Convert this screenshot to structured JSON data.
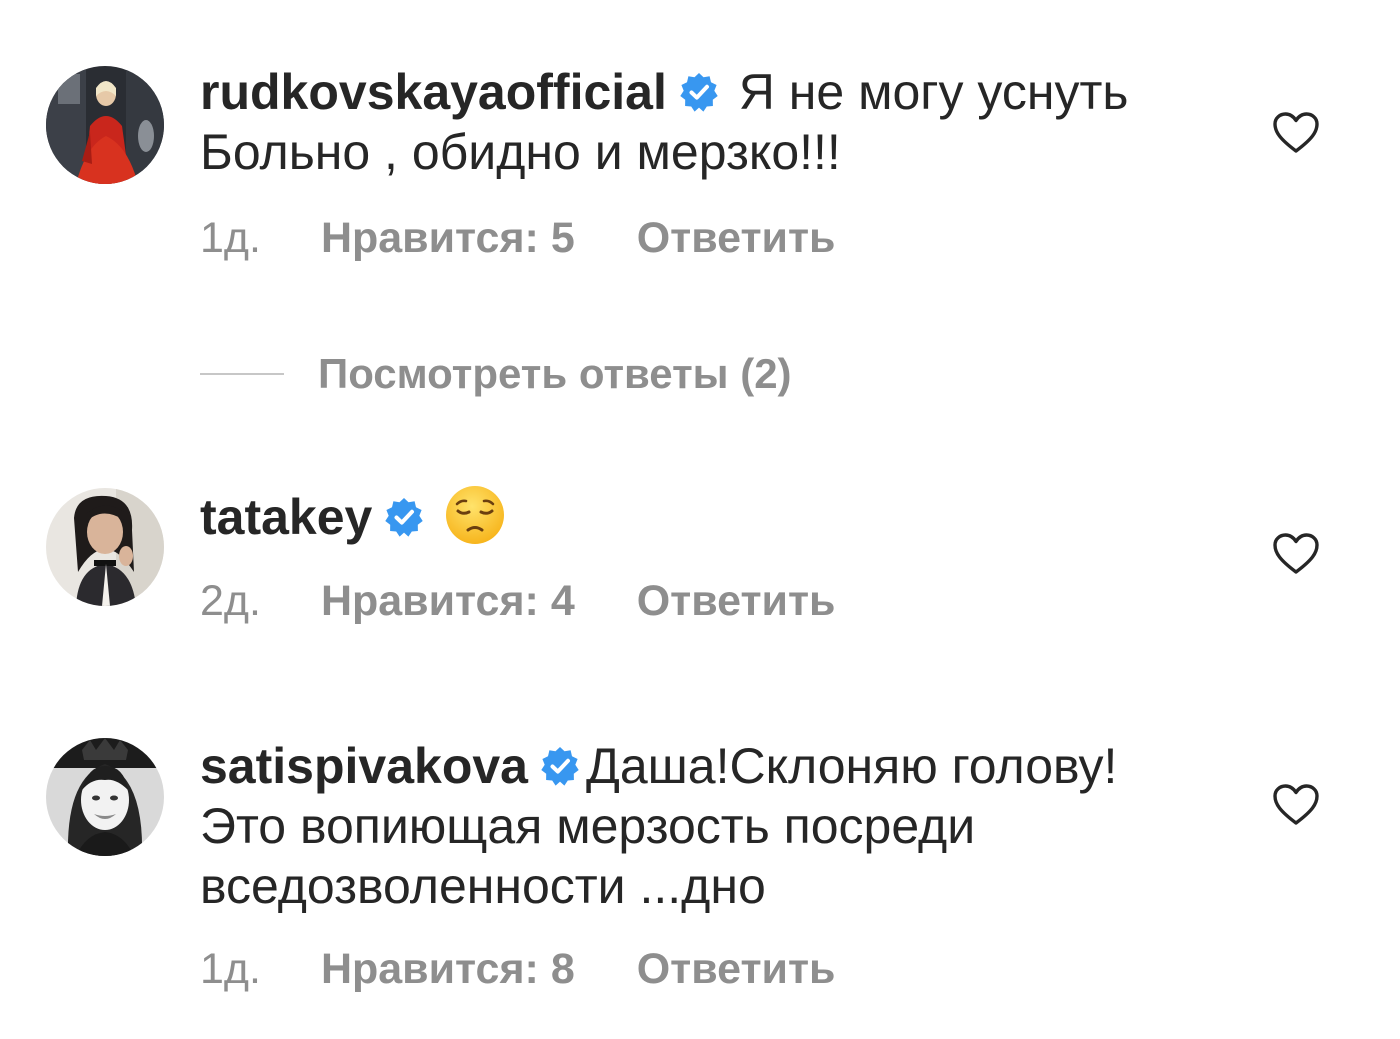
{
  "colors": {
    "text": "#262626",
    "secondary": "#8e8e8e",
    "verified": "#3897f0",
    "divider": "#c7c7c7"
  },
  "comments": [
    {
      "username": "rudkovskayaofficial",
      "verified": true,
      "text_line1": "Я не могу уснуть",
      "text_line2": "Больно , обидно и мерзко!!!",
      "time": "1д.",
      "likes": "Нравится: 5",
      "reply": "Ответить",
      "like_icon": "heart-outline-icon"
    },
    {
      "username": "tatakey",
      "verified": true,
      "emoji": "pensive-face-emoji",
      "time": "2д.",
      "likes": "Нравится: 4",
      "reply": "Ответить",
      "like_icon": "heart-outline-icon"
    },
    {
      "username": "satispivakova",
      "verified": true,
      "text_line1": "Даша!Склоняю голову!",
      "text_line2": "Это вопиющая мерзость посреди",
      "text_line3": "вседозволенности ...дно",
      "time": "1д.",
      "likes": "Нравится: 8",
      "reply": "Ответить",
      "like_icon": "heart-outline-icon"
    }
  ],
  "view_replies": "Посмотреть ответы (2)"
}
